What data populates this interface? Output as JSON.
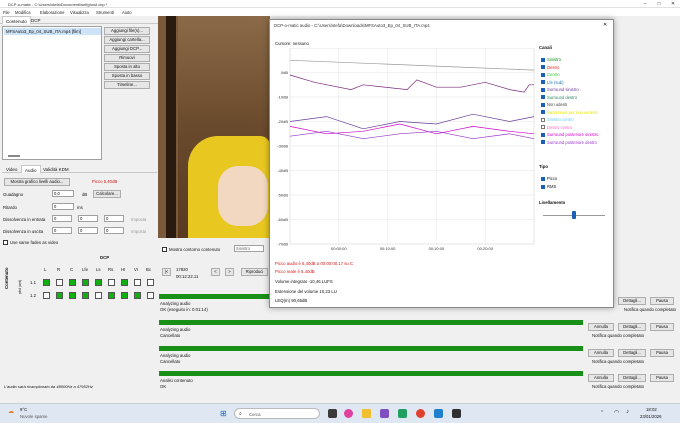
{
  "window": {
    "title": "DCP-o-matic - C:\\Users\\stefa\\Documenti\\selfghost.dcp *"
  },
  "menu": [
    "File",
    "Modifica",
    "Elaborazione",
    "Visualizza",
    "Strumenti",
    "Aiuto"
  ],
  "main_tabs": [
    "Contenuto",
    "DCP"
  ],
  "content": {
    "file": "MFSAuto3_Ep_04_SUB_ITA.mp4 [film]",
    "buttons": [
      "Aggiungi file(s)...",
      "Aggiungi cartella...",
      "Aggiungi DCP...",
      "Rimuovi",
      "Sposta in alto",
      "Sposta in basso",
      "Timeline..."
    ]
  },
  "sub_tabs": [
    "Video",
    "Audio",
    "Validità KDM"
  ],
  "audio": {
    "show_graph": "Mostra grafico livelli audio...",
    "peak": "Picco 5,40dB",
    "gain_label": "Guadagno",
    "gain_value": "0,0",
    "gain_unit": "dB",
    "calc": "Calcolare...",
    "delay_label": "Ritardo",
    "delay_value": "0",
    "delay_unit": "ms",
    "fade_in_label": "Dissolvenza in entrata",
    "fade_out_label": "Dissolvenza in uscita",
    "fade_values": [
      "0",
      "0",
      "0",
      "0"
    ],
    "set_label": "Imposta",
    "same_fades": "Use same fades as video",
    "matrix_title": "DCP",
    "matrix_cols": [
      "L",
      "R",
      "C",
      "Lfe",
      "Ls",
      "Rs",
      "HI",
      "VI",
      "Bc"
    ],
    "matrix_rows": [
      "1.1",
      "1.2"
    ],
    "matrix_side": "Contenuto",
    "matrix_rowhead": "ptst (ant)",
    "resample_note": "L'audio sarà ricampionato da 48000Hz a 47952Hz"
  },
  "player": {
    "outline": "Mostra contorno contenuto",
    "left_eye": "Sinistro",
    "frame": "17820",
    "timecode": "00:12:22.11",
    "play": "Riproduci",
    "nav": [
      "|<",
      "<",
      ">"
    ]
  },
  "jobs": [
    {
      "title": "Analyzing audio",
      "status": "OK (eseguito in: 0:01:14)",
      "fill": 1.0
    },
    {
      "title": "Analyzing audio",
      "status": "Cancellato",
      "fill": 1.0
    },
    {
      "title": "Analyzing audio",
      "status": "Cancellato",
      "fill": 1.0
    },
    {
      "title": "Analisi contenuto",
      "status": "OK",
      "fill": 1.0
    }
  ],
  "job_buttons": {
    "cancel": "Annulla",
    "details": "Dettagli...",
    "pause": "Pausa",
    "notify": "Notifica quando completato"
  },
  "dialog": {
    "title": "DCP-o-matic audio - C:\\Users\\stefa\\Downloads\\MFSAuto3_Ep_04_SUB_ITA.mp4",
    "cursor": "Cursore: nessuno",
    "close": "✕",
    "peak_line": "Picco audio è 5,40dB a 00:00:00.17 su C",
    "peak_rms": "Picco reale è 5,40dB",
    "integrated": "Volume integrato -10,46 LUFS",
    "range": "Estensione del volume 10,23 LU",
    "leq": "LEQ(m) 90,65dB",
    "channels_title": "Canali",
    "channels": [
      {
        "name": "Sinistro",
        "on": true,
        "color": "#1a8a1a"
      },
      {
        "name": "Destro",
        "on": true,
        "color": "#e31a1c"
      },
      {
        "name": "Centro",
        "on": true,
        "color": "#33cc33"
      },
      {
        "name": "Lfe (sub)",
        "on": true,
        "color": "#1f78b4"
      },
      {
        "name": "Surround sinistro",
        "on": true,
        "color": "#6a3d9a"
      },
      {
        "name": "Surround destro",
        "on": true,
        "color": "#2a8a5a"
      },
      {
        "name": "Non udenti",
        "on": true,
        "color": "#444444"
      },
      {
        "name": "Narrazione per non vedenti",
        "on": true,
        "color": "#e6e600"
      },
      {
        "name": "Sinistro centro",
        "on": false,
        "color": "#66ccff"
      },
      {
        "name": "Destro centro",
        "on": false,
        "color": "#ff66cc"
      },
      {
        "name": "Surround posteriore sinistro",
        "on": true,
        "color": "#cc00cc"
      },
      {
        "name": "Surround posteriore destro",
        "on": true,
        "color": "#9933cc"
      }
    ],
    "type_title": "Tipo",
    "types": [
      {
        "name": "Picco",
        "on": true
      },
      {
        "name": "RMS",
        "on": true
      }
    ],
    "smoothing_title": "Livellamento",
    "smoothing": 0.5
  },
  "chart_data": {
    "type": "line",
    "ylim": [
      -70,
      10
    ],
    "yticks": [
      "0dB",
      "-10dB",
      "-20dB",
      "-30dB",
      "-40dB",
      "-50dB",
      "-60dB",
      "-70dB"
    ],
    "yvalues": [
      0,
      -10,
      -20,
      -30,
      -40,
      -50,
      -60,
      -70
    ],
    "xticks": [
      "00:00:00",
      "00:10:00",
      "00:10:00",
      "00:20:00"
    ],
    "xlim": [
      0,
      100
    ],
    "series": [
      {
        "name": "Lfe (sub)",
        "color": "#999999",
        "points": [
          [
            0,
            5
          ],
          [
            25,
            4
          ],
          [
            50,
            3
          ],
          [
            75,
            2
          ],
          [
            100,
            1
          ]
        ]
      },
      {
        "name": "Picco",
        "color": "#7a2a7a",
        "points": [
          [
            0,
            -1
          ],
          [
            10,
            -4
          ],
          [
            25,
            -7
          ],
          [
            30,
            -5
          ],
          [
            48,
            -7
          ],
          [
            52,
            -3
          ],
          [
            60,
            -6
          ],
          [
            70,
            -6
          ],
          [
            80,
            -4
          ],
          [
            90,
            -7
          ],
          [
            96,
            -8
          ],
          [
            98,
            -5
          ],
          [
            100,
            -5
          ]
        ]
      },
      {
        "name": "Surround sinistro",
        "color": "#6a3d9a",
        "points": [
          [
            0,
            -20
          ],
          [
            15,
            -18
          ],
          [
            30,
            -23
          ],
          [
            45,
            -20
          ],
          [
            60,
            -21
          ],
          [
            75,
            -17
          ],
          [
            90,
            -20
          ],
          [
            100,
            -18
          ]
        ]
      },
      {
        "name": "Surround posteriore sinistro",
        "color": "#cc00cc",
        "points": [
          [
            0,
            -22
          ],
          [
            15,
            -25
          ],
          [
            30,
            -24
          ],
          [
            45,
            -21
          ],
          [
            60,
            -25
          ],
          [
            75,
            -22
          ],
          [
            90,
            -24
          ],
          [
            100,
            -25
          ]
        ]
      },
      {
        "name": "Surround posteriore destro",
        "color": "#9933cc",
        "points": [
          [
            0,
            -26
          ],
          [
            15,
            -24
          ],
          [
            30,
            -27
          ],
          [
            45,
            -25
          ],
          [
            60,
            -24
          ],
          [
            75,
            -27
          ],
          [
            90,
            -25
          ],
          [
            100,
            -27
          ]
        ]
      }
    ]
  },
  "taskbar": {
    "weather_temp": "9°C",
    "weather_desc": "Nuvole sparse",
    "search": "Cerca",
    "time": "18:02",
    "date": "23/01/2026"
  }
}
